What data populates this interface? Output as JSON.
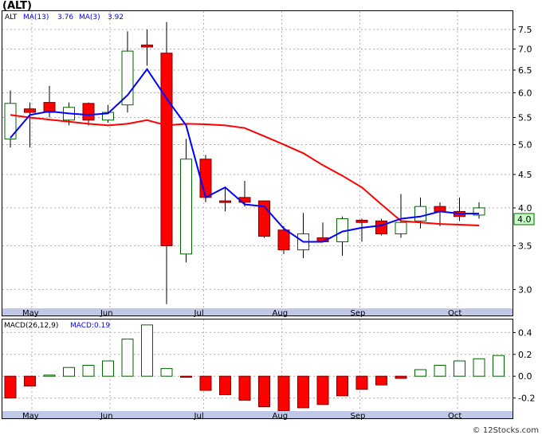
{
  "title": "(ALT)",
  "watermark": "© 12Stocks.com",
  "colors": {
    "up_candle": "#006400",
    "down_candle": "#ff0000",
    "ma13": "#ff0000",
    "ma3": "#0000ff",
    "grid": "#b0b0b0",
    "panel_border": "#000000",
    "price_box": "#c8ffc8",
    "axis_strip": "#bfc8e6",
    "macd_pos": "#006400",
    "macd_neg": "#ff0000"
  },
  "legend": {
    "ticker": "ALT",
    "ma13_label": "MA(13)",
    "ma13_value": "3.76",
    "ma3_label": "MA(3)",
    "ma3_value": "3.92"
  },
  "macd_legend": {
    "label": "MACD(26,12,9)",
    "value_label": "MACD:0.19"
  },
  "last_price_label": "4.0",
  "chart_data": [
    {
      "type": "candlestick",
      "scale": "log",
      "ylim": [
        2.8,
        8.0
      ],
      "y_ticks": [
        3.0,
        3.5,
        4.0,
        4.5,
        5.0,
        5.5,
        6.0,
        6.5,
        7.0,
        7.5
      ],
      "y_tick_labels": [
        "3.0",
        "3.5",
        "4.0",
        "4.5",
        "5.0",
        "5.5",
        "6.0",
        "6.5",
        "7.0",
        "7.5"
      ],
      "x_tick_labels": [
        "May",
        "Jun",
        "Jul",
        "Aug",
        "Sep",
        "Oct"
      ],
      "x_tick_index": [
        1.1,
        5.1,
        9.9,
        13.9,
        17.9,
        22.9
      ],
      "candles": [
        {
          "o": 5.1,
          "h": 6.05,
          "l": 4.95,
          "c": 5.78
        },
        {
          "o": 5.67,
          "h": 5.8,
          "l": 4.95,
          "c": 5.6
        },
        {
          "o": 5.8,
          "h": 6.15,
          "l": 5.5,
          "c": 5.6
        },
        {
          "o": 5.45,
          "h": 5.8,
          "l": 5.35,
          "c": 5.7
        },
        {
          "o": 5.78,
          "h": 5.8,
          "l": 5.35,
          "c": 5.45
        },
        {
          "o": 5.45,
          "h": 5.75,
          "l": 5.4,
          "c": 5.6
        },
        {
          "o": 5.75,
          "h": 7.45,
          "l": 5.6,
          "c": 6.95
        },
        {
          "o": 7.1,
          "h": 7.5,
          "l": 6.6,
          "c": 7.05
        },
        {
          "o": 6.9,
          "h": 7.7,
          "l": 2.85,
          "c": 3.5
        },
        {
          "o": 3.4,
          "h": 5.1,
          "l": 3.3,
          "c": 4.75
        },
        {
          "o": 4.75,
          "h": 4.82,
          "l": 4.08,
          "c": 4.15
        },
        {
          "o": 4.1,
          "h": 4.3,
          "l": 3.95,
          "c": 4.08
        },
        {
          "o": 4.15,
          "h": 4.4,
          "l": 4.02,
          "c": 4.08
        },
        {
          "o": 4.1,
          "h": 4.1,
          "l": 3.6,
          "c": 3.62
        },
        {
          "o": 3.7,
          "h": 3.75,
          "l": 3.4,
          "c": 3.45
        },
        {
          "o": 3.45,
          "h": 3.93,
          "l": 3.35,
          "c": 3.65
        },
        {
          "o": 3.6,
          "h": 3.8,
          "l": 3.55,
          "c": 3.55
        },
        {
          "o": 3.55,
          "h": 3.88,
          "l": 3.38,
          "c": 3.85
        },
        {
          "o": 3.83,
          "h": 3.85,
          "l": 3.55,
          "c": 3.8
        },
        {
          "o": 3.82,
          "h": 3.85,
          "l": 3.63,
          "c": 3.65
        },
        {
          "o": 3.65,
          "h": 4.2,
          "l": 3.6,
          "c": 3.8
        },
        {
          "o": 3.82,
          "h": 4.15,
          "l": 3.72,
          "c": 4.02
        },
        {
          "o": 4.02,
          "h": 4.08,
          "l": 3.75,
          "c": 3.95
        },
        {
          "o": 3.95,
          "h": 4.15,
          "l": 3.82,
          "c": 3.88
        },
        {
          "o": 3.9,
          "h": 4.08,
          "l": 3.85,
          "c": 4.0
        }
      ],
      "ma13": [
        5.55,
        5.5,
        5.46,
        5.42,
        5.38,
        5.35,
        5.38,
        5.45,
        5.35,
        5.38,
        5.37,
        5.35,
        5.3,
        5.15,
        5.0,
        4.85,
        4.65,
        4.48,
        4.3,
        4.05,
        3.82,
        3.8,
        3.78,
        3.77,
        3.76
      ],
      "ma3": [
        5.12,
        5.55,
        5.62,
        5.58,
        5.55,
        5.58,
        5.95,
        6.52,
        5.88,
        5.35,
        4.15,
        4.3,
        4.05,
        4.02,
        3.72,
        3.55,
        3.55,
        3.68,
        3.73,
        3.76,
        3.85,
        3.88,
        3.95,
        3.92,
        3.92
      ]
    },
    {
      "type": "bar",
      "title": "MACD(26,12,9)",
      "ylim": [
        -0.32,
        0.52
      ],
      "y_ticks": [
        -0.2,
        0.0,
        0.2,
        0.4
      ],
      "y_tick_labels": [
        "-0.2",
        "0.0",
        "0.2",
        "0.4"
      ],
      "values": [
        -0.2,
        -0.09,
        0.01,
        0.08,
        0.1,
        0.14,
        0.34,
        0.47,
        0.07,
        -0.01,
        -0.13,
        -0.17,
        -0.22,
        -0.28,
        -0.32,
        -0.29,
        -0.26,
        -0.18,
        -0.12,
        -0.08,
        -0.02,
        0.06,
        0.1,
        0.14,
        0.16,
        0.19
      ]
    }
  ]
}
